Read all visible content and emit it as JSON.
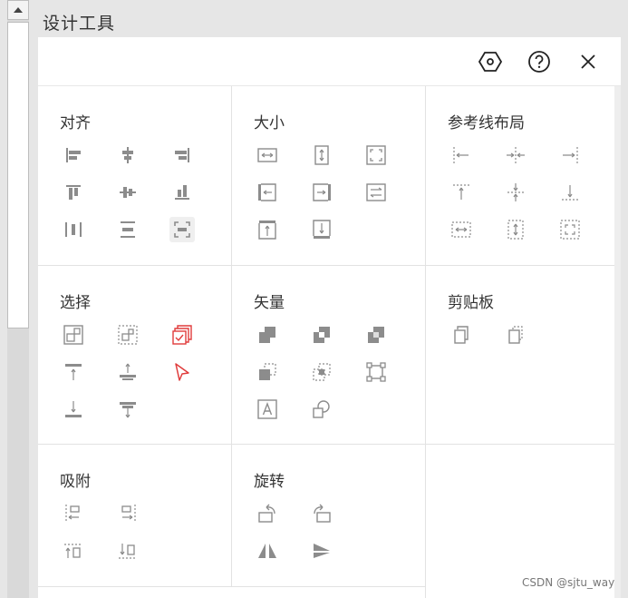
{
  "page_title": "设计工具",
  "sections": {
    "align": {
      "title": "对齐"
    },
    "size": {
      "title": "大小"
    },
    "guide": {
      "title": "参考线布局"
    },
    "select": {
      "title": "选择"
    },
    "vector": {
      "title": "矢量"
    },
    "clipboard": {
      "title": "剪贴板"
    },
    "snap": {
      "title": "吸附"
    },
    "rotate": {
      "title": "旋转"
    }
  },
  "watermark": "CSDN @sjtu_way",
  "colors": {
    "icon_gray": "#8c8c8c",
    "accent_red": "#e03c3c",
    "highlight_bg": "#efefef"
  }
}
